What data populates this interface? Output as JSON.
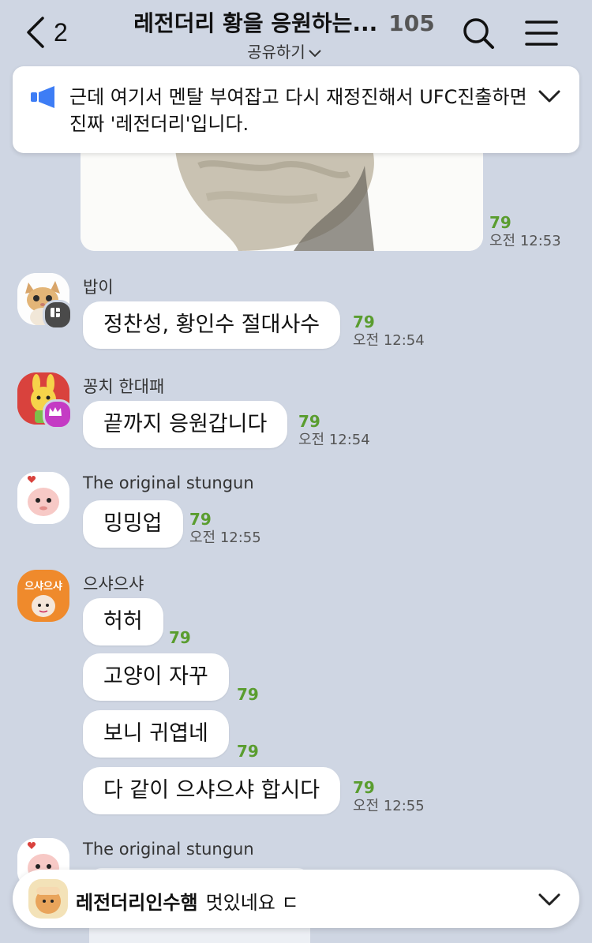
{
  "header": {
    "back_count": "2",
    "title": "레전더리 황을 응원하는...",
    "member_count": "105",
    "share_label": "공유하기"
  },
  "notice": {
    "text": "근데 여기서 멘탈 부여잡고 다시 재정진해서 UFC진출하면 진짜 '레전더리'입니다."
  },
  "photo_message": {
    "unread": "79",
    "time": "오전 12:53"
  },
  "messages": [
    {
      "sender": "밥이",
      "text": "정찬성, 황인수 절대사수",
      "unread": "79",
      "time": "오전 12:54"
    },
    {
      "sender": "꽁치 한대패",
      "text": "끝까지 응원갑니다",
      "unread": "79",
      "time": "오전 12:54"
    },
    {
      "sender": "The original stungun",
      "text": "밍밍업",
      "unread": "79",
      "time": "오전 12:55"
    },
    {
      "sender": "으샤으샤",
      "avatar_text": "으샤으샤",
      "lines": [
        {
          "text": "허허",
          "unread": "79"
        },
        {
          "text": "고양이 자꾸",
          "unread": "79"
        },
        {
          "text": "보니 귀엽네",
          "unread": "79"
        },
        {
          "text": "다 같이 으샤으샤 합시다",
          "unread": "79",
          "time": "오전 12:55"
        }
      ]
    },
    {
      "sender": "The original stungun"
    }
  ],
  "bottom_preview": {
    "name": "레전더리인수햄",
    "text": "멋있네요 ㄷ"
  },
  "colors": {
    "background": "#cfd6e3",
    "unread": "#5a9d2f",
    "notice_icon": "#3d7df5"
  }
}
